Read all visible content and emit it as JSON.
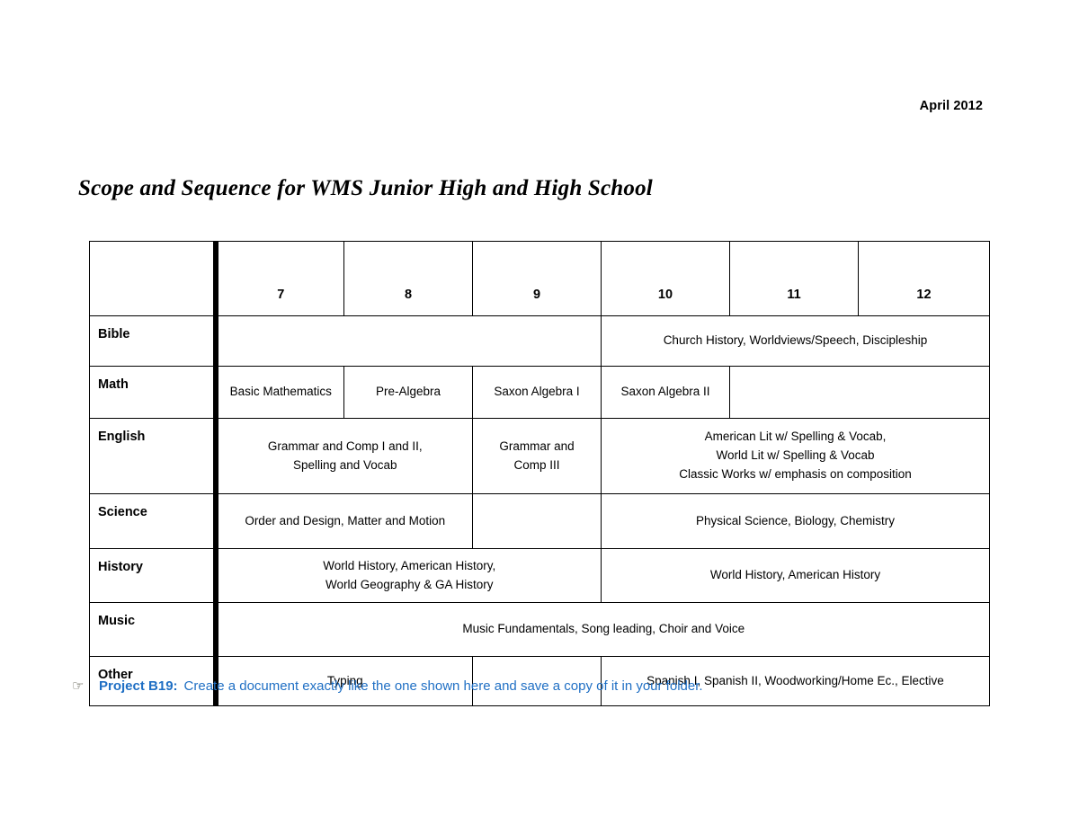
{
  "document": {
    "date": "April 2012",
    "title": "Scope and Sequence for WMS Junior High and High School"
  },
  "table": {
    "corner_label": "",
    "grades": [
      "7",
      "8",
      "9",
      "10",
      "11",
      "12"
    ],
    "rows": [
      {
        "label": "Bible",
        "cells": [
          {
            "text": "",
            "span": 3,
            "thick_left": true
          },
          {
            "text": "Church History, Worldviews/Speech, Discipleship",
            "span": 3,
            "thick_left": true
          }
        ]
      },
      {
        "label": "Math",
        "cells": [
          {
            "text": "Basic Mathematics",
            "span": 1,
            "thick_left": true
          },
          {
            "text": "Pre-Algebra",
            "span": 1,
            "thick_left": false
          },
          {
            "text": "Saxon Algebra I",
            "span": 1,
            "thick_left": false
          },
          {
            "text": "Saxon Algebra II",
            "span": 1,
            "thick_left": true
          },
          {
            "text": "",
            "span": 2,
            "thick_left": false
          }
        ]
      },
      {
        "label": "English",
        "cells": [
          {
            "text": "Grammar and Comp I and II,\nSpelling and Vocab",
            "span": 2,
            "thick_left": true
          },
          {
            "text": "Grammar and\nComp III",
            "span": 1,
            "thick_left": false
          },
          {
            "text": "American Lit w/ Spelling & Vocab,\nWorld Lit w/ Spelling & Vocab\nClassic Works w/ emphasis on composition",
            "span": 3,
            "thick_left": true
          }
        ]
      },
      {
        "label": "Science",
        "cells": [
          {
            "text": "Order and Design, Matter and Motion",
            "span": 2,
            "thick_left": true
          },
          {
            "text": "",
            "span": 1,
            "thick_left": false
          },
          {
            "text": "Physical Science, Biology, Chemistry",
            "span": 3,
            "thick_left": true
          }
        ]
      },
      {
        "label": "History",
        "cells": [
          {
            "text": "World History, American History,\nWorld Geography & GA History",
            "span": 3,
            "thick_left": true
          },
          {
            "text": "World History, American History",
            "span": 3,
            "thick_left": true
          }
        ]
      },
      {
        "label": "Music",
        "cells": [
          {
            "text": "Music Fundamentals, Song leading, Choir and Voice",
            "span": 6,
            "thick_left": true
          }
        ]
      },
      {
        "label": "Other",
        "cells": [
          {
            "text": "Typing",
            "span": 2,
            "thick_left": true
          },
          {
            "text": "",
            "span": 1,
            "thick_left": false
          },
          {
            "text": "Spanish I, Spanish II, Woodworking/Home Ec., Elective",
            "span": 3,
            "thick_left": true
          }
        ]
      }
    ]
  },
  "footer": {
    "bullet_icon": "pointing-hand-icon",
    "bullet_glyph": "☞",
    "project_label": "Project B19:",
    "project_text": "Create a document exactly like the one shown here and save a copy of it in your folder.",
    "accent_color": "#1F6FC4"
  }
}
